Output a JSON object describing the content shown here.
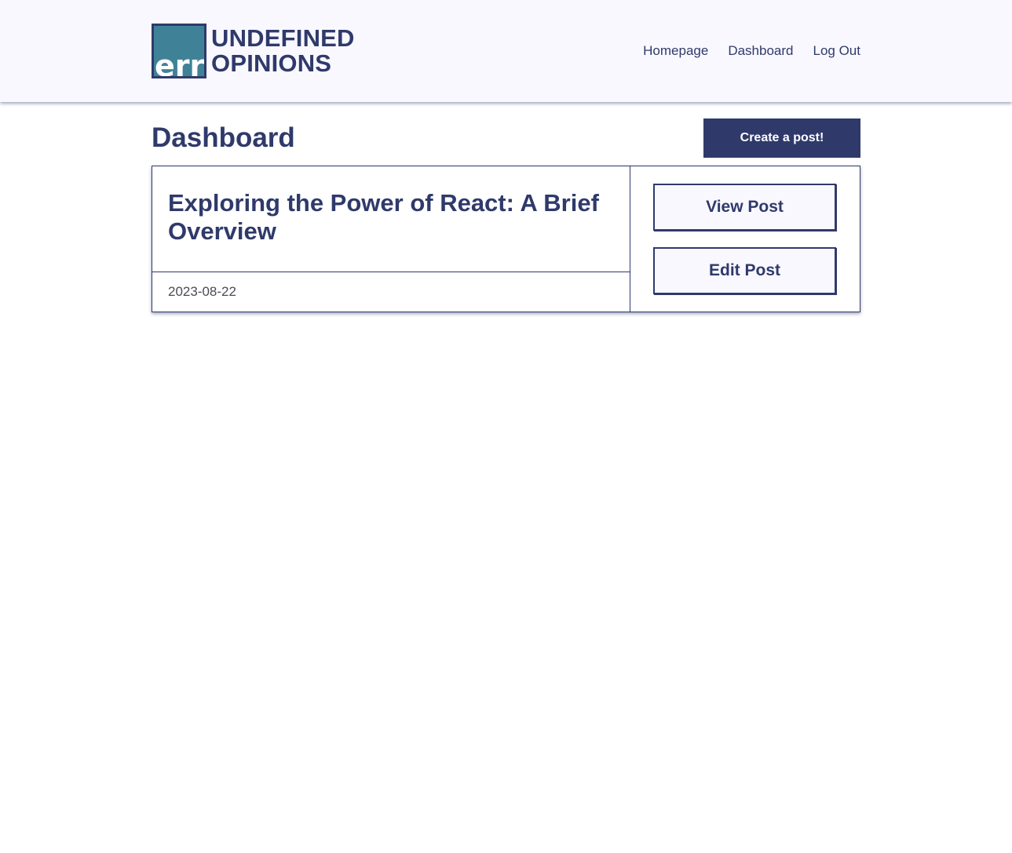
{
  "header": {
    "logo": {
      "mark_text": "err",
      "line1": "UNDEFINED",
      "line2": "OPINIONS"
    },
    "nav": [
      "Homepage",
      "Dashboard",
      "Log Out"
    ]
  },
  "page": {
    "title": "Dashboard",
    "create_label": "Create a post!"
  },
  "posts": [
    {
      "title": "Exploring the Power of React: A Brief Overview",
      "date": "2023-08-22",
      "view_label": "View Post",
      "edit_label": "Edit Post"
    }
  ],
  "colors": {
    "primary": "#2f3a6b",
    "header_bg": "#f9f8fe",
    "logo_bg": "#3f8298",
    "button_bg": "#f9f8fe"
  }
}
